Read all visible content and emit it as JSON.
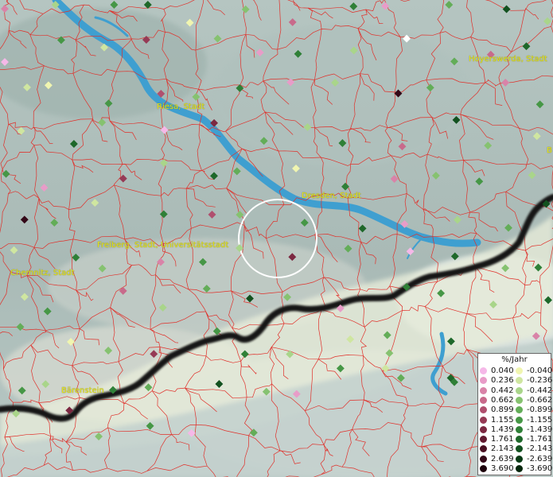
{
  "cities": [
    {
      "name": "Hoyerswerda, Stadt"
    },
    {
      "name": "Riesa, Stadt"
    },
    {
      "name": "Dresden, Stadt"
    },
    {
      "name": "Freiberg, Stadt, Universitätsstadt"
    },
    {
      "name": "Chemnitz, Stadt"
    },
    {
      "name": "Bärenstein"
    },
    {
      "name": "B"
    }
  ],
  "legend": {
    "title": "%/Jahr",
    "positive": [
      {
        "label": "0.040",
        "color": "#f5b8e8"
      },
      {
        "label": "0.236",
        "color": "#e89cc8"
      },
      {
        "label": "0.442",
        "color": "#d983a8"
      },
      {
        "label": "0.662",
        "color": "#c86a8b"
      },
      {
        "label": "0.899",
        "color": "#b04f6e"
      },
      {
        "label": "1.155",
        "color": "#963a55"
      },
      {
        "label": "1.439",
        "color": "#7c2841"
      },
      {
        "label": "1.761",
        "color": "#621a30"
      },
      {
        "label": "2.143",
        "color": "#4a1022"
      },
      {
        "label": "2.639",
        "color": "#330817"
      },
      {
        "label": "3.690",
        "color": "#1e030c"
      }
    ],
    "negative": [
      {
        "label": "-0.040",
        "color": "#f0f5b0"
      },
      {
        "label": "-0.236",
        "color": "#cfe6a0"
      },
      {
        "label": "-0.442",
        "color": "#a9d58a"
      },
      {
        "label": "-0.662",
        "color": "#86c270"
      },
      {
        "label": "-0.899",
        "color": "#63ad58"
      },
      {
        "label": "-1.155",
        "color": "#469746"
      },
      {
        "label": "-1.439",
        "color": "#2f8037"
      },
      {
        "label": "-1.761",
        "color": "#1e682a"
      },
      {
        "label": "-2.143",
        "color": "#12511f"
      },
      {
        "label": "-2.639",
        "color": "#093b15"
      },
      {
        "label": "-3.690",
        "color": "#03260b"
      }
    ]
  },
  "colors": {
    "boundary": "#e0302a",
    "river": "#3f9fd0",
    "border": "#151515",
    "city_label": "#e6e61a",
    "highlight_circle": "#ffffff"
  },
  "markers": [
    [
      "#d983a8"
    ],
    [
      "#a9d58a"
    ],
    [
      "#469746"
    ],
    [
      "#1e682a"
    ],
    [
      "#f0f5b0"
    ],
    [
      "#86c270"
    ],
    [
      "#c86a8b"
    ],
    [
      "#2f8037"
    ],
    [
      "#e89cc8"
    ],
    [
      "#63ad58"
    ],
    [
      "#12511f"
    ],
    [
      "#a9d58a"
    ],
    [
      "#f5b8e8"
    ],
    [
      "#469746"
    ],
    [
      "#cfe6a0"
    ],
    [
      "#963a55"
    ],
    [
      "#86c270"
    ],
    [
      "#e89cc8"
    ],
    [
      "#2f8037"
    ],
    [
      "#a9d58a"
    ],
    [
      "#ffffff"
    ],
    [
      "#63ad58"
    ],
    [
      "#c86a8b"
    ],
    [
      "#1e682a"
    ],
    [
      "#cfe6a0"
    ],
    [
      "#f0f5b0"
    ],
    [
      "#469746"
    ],
    [
      "#b04f6e"
    ],
    [
      "#86c270"
    ],
    [
      "#2f8037"
    ],
    [
      "#e89cc8"
    ],
    [
      "#a9d58a"
    ],
    [
      "#330817"
    ],
    [
      "#63ad58"
    ],
    [
      "#d983a8"
    ],
    [
      "#469746"
    ],
    [
      "#cfe6a0"
    ],
    [
      "#1e682a"
    ],
    [
      "#86c270"
    ],
    [
      "#f5b8e8"
    ],
    [
      "#7c2841"
    ],
    [
      "#63ad58"
    ],
    [
      "#a9d58a"
    ],
    [
      "#2f8037"
    ],
    [
      "#c86a8b"
    ],
    [
      "#12511f"
    ],
    [
      "#86c270"
    ],
    [
      "#cfe6a0"
    ],
    [
      "#469746"
    ],
    [
      "#e89cc8"
    ],
    [
      "#963a55"
    ],
    [
      "#a9d58a"
    ],
    [
      "#1e682a"
    ],
    [
      "#63ad58"
    ],
    [
      "#f0f5b0"
    ],
    [
      "#2f8037"
    ],
    [
      "#d983a8"
    ],
    [
      "#86c270"
    ],
    [
      "#469746"
    ],
    [
      "#a9d58a"
    ],
    [
      "#330817"
    ],
    [
      "#63ad58"
    ],
    [
      "#cfe6a0"
    ],
    [
      "#2f8037"
    ],
    [
      "#b04f6e"
    ],
    [
      "#86c270"
    ],
    [
      "#469746"
    ],
    [
      "#1e682a"
    ],
    [
      "#e89cc8"
    ],
    [
      "#a9d58a"
    ],
    [
      "#63ad58"
    ],
    [
      "#12511f"
    ],
    [
      "#cfe6a0"
    ],
    [
      "#2f8037"
    ],
    [
      "#86c270"
    ],
    [
      "#d983a8"
    ],
    [
      "#469746"
    ],
    [
      "#a9d58a"
    ],
    [
      "#7c2841"
    ],
    [
      "#63ad58"
    ],
    [
      "#f5b8e8"
    ],
    [
      "#1e682a"
    ],
    [
      "#86c270"
    ],
    [
      "#2f8037"
    ],
    [
      "#cfe6a0"
    ],
    [
      "#469746"
    ],
    [
      "#c86a8b"
    ],
    [
      "#a9d58a"
    ],
    [
      "#63ad58"
    ],
    [
      "#12511f"
    ],
    [
      "#86c270"
    ],
    [
      "#e89cc8"
    ],
    [
      "#2f8037"
    ],
    [
      "#469746"
    ],
    [
      "#a9d58a"
    ],
    [
      "#1e682a"
    ],
    [
      "#63ad58"
    ],
    [
      "#f0f5b0"
    ],
    [
      "#86c270"
    ],
    [
      "#963a55"
    ],
    [
      "#469746"
    ],
    [
      "#2f8037"
    ],
    [
      "#a9d58a"
    ],
    [
      "#cfe6a0"
    ],
    [
      "#63ad58"
    ],
    [
      "#1e682a"
    ],
    [
      "#86c270"
    ],
    [
      "#d983a8"
    ],
    [
      "#469746"
    ],
    [
      "#a9d58a"
    ],
    [
      "#2f8037"
    ],
    [
      "#63ad58"
    ],
    [
      "#12511f"
    ],
    [
      "#86c270"
    ],
    [
      "#e89cc8"
    ],
    [
      "#469746"
    ],
    [
      "#cfe6a0"
    ],
    [
      "#1e682a"
    ],
    [
      "#63ad58"
    ],
    [
      "#2f8037"
    ],
    [
      "#a9d58a"
    ],
    [
      "#7c2841"
    ],
    [
      "#86c270"
    ],
    [
      "#469746"
    ],
    [
      "#f5b8e8"
    ],
    [
      "#63ad58"
    ]
  ]
}
